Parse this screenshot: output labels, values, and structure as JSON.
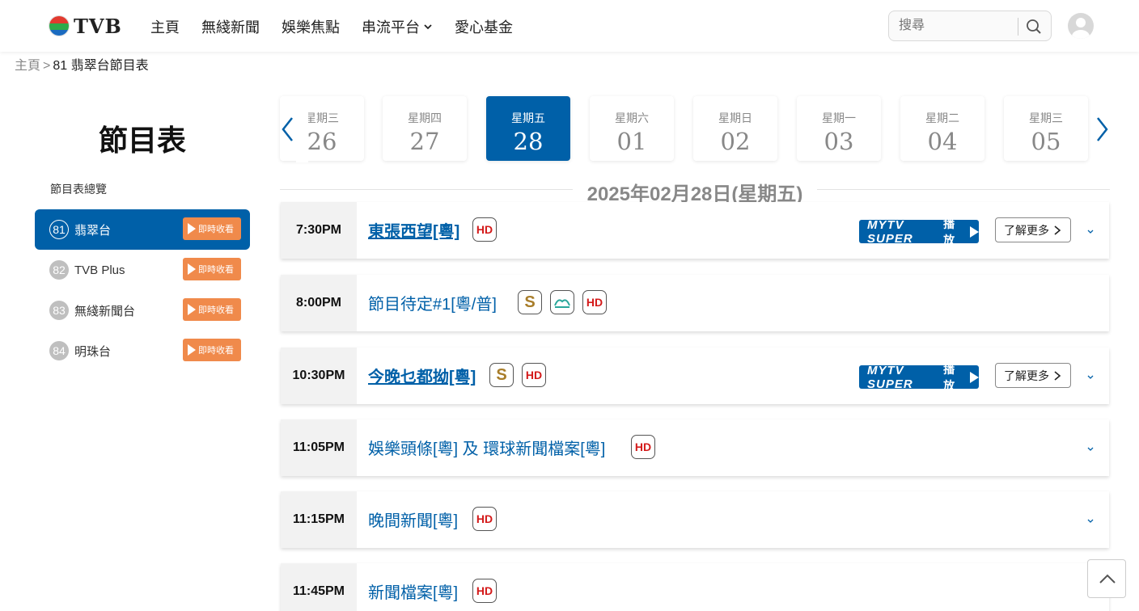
{
  "header": {
    "logo_text": "TVB",
    "nav": [
      "主頁",
      "無綫新聞",
      "娛樂焦點",
      "串流平台",
      "愛心基金"
    ],
    "search_placeholder": "搜尋"
  },
  "breadcrumb": {
    "home": "主頁",
    "separator": ">",
    "current": "81 翡翠台節目表"
  },
  "sidebar": {
    "title": "節目表",
    "overview": "節目表總覽",
    "live_label": "即時收看",
    "channels": [
      {
        "num": "81",
        "name": "翡翠台"
      },
      {
        "num": "82",
        "name": "TVB Plus"
      },
      {
        "num": "83",
        "name": "無綫新聞台"
      },
      {
        "num": "84",
        "name": "明珠台"
      }
    ]
  },
  "dates": [
    {
      "weekday": "星期三",
      "day": "26"
    },
    {
      "weekday": "星期四",
      "day": "27"
    },
    {
      "weekday": "星期五",
      "day": "28"
    },
    {
      "weekday": "星期六",
      "day": "01"
    },
    {
      "weekday": "星期日",
      "day": "02"
    },
    {
      "weekday": "星期一",
      "day": "03"
    },
    {
      "weekday": "星期二",
      "day": "04"
    },
    {
      "weekday": "星期三",
      "day": "05"
    }
  ],
  "date_heading": "2025年02月28日(星期五)",
  "mytv": {
    "brand": "MYTV SUPER",
    "play": "播放"
  },
  "more_label": "了解更多",
  "programmes": [
    {
      "time": "7:30PM",
      "title": "東張西望[粵]",
      "badges": [
        "HD"
      ]
    },
    {
      "time": "8:00PM",
      "title": "節目待定#1[粵/普]",
      "badges": [
        "S",
        "sign",
        "HD"
      ]
    },
    {
      "time": "10:30PM",
      "title": "今晚乜都拗[粵]",
      "badges": [
        "S",
        "HD"
      ]
    },
    {
      "time": "11:05PM",
      "title": "娛樂頭條[粵] 及 環球新聞檔案[粵]",
      "badges": [
        "HD"
      ]
    },
    {
      "time": "11:15PM",
      "title": "晚間新聞[粵]",
      "badges": [
        "HD"
      ]
    },
    {
      "time": "11:45PM",
      "title": "新聞檔案[粵]",
      "badges": [
        "HD"
      ]
    }
  ],
  "colors": {
    "brand_blue": "#0060a8",
    "live_orange": "#f08a4b",
    "hd_red": "#d41a1a"
  }
}
